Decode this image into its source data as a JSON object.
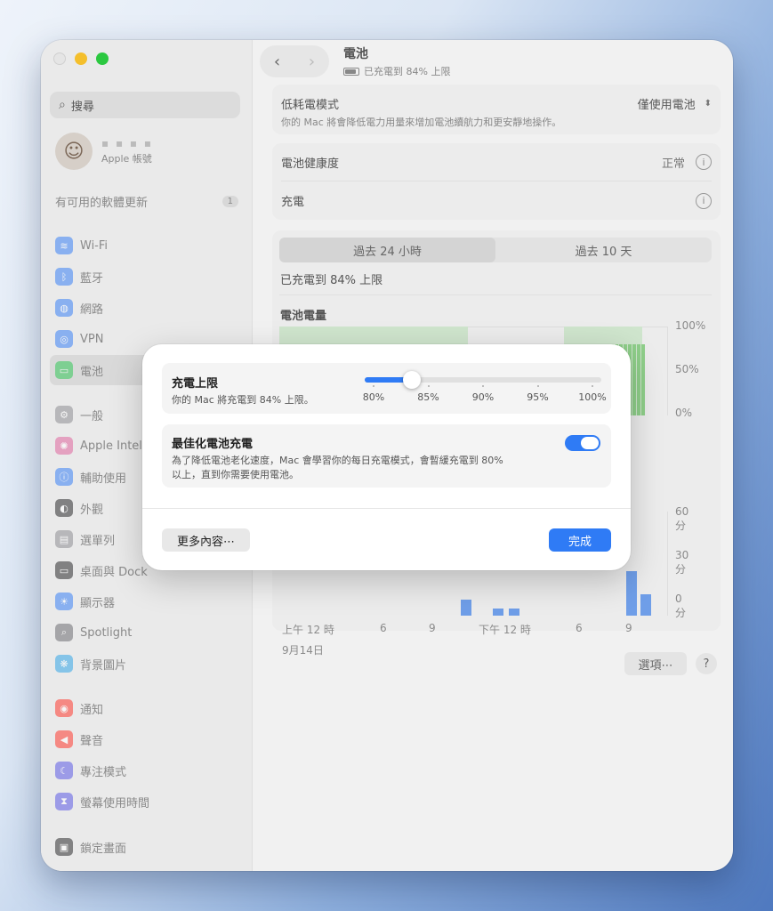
{
  "sidebar": {
    "search_placeholder": "搜尋",
    "account_name": "▪ ▪ ▪ ▪",
    "account_sub": "Apple 帳號",
    "update_label": "有可用的軟體更新",
    "update_count": "1",
    "items": [
      {
        "label": "Wi-Fi",
        "color": "#3b82f6",
        "glyph": "≋"
      },
      {
        "label": "藍牙",
        "color": "#3b82f6",
        "glyph": "ᛒ"
      },
      {
        "label": "網路",
        "color": "#3b82f6",
        "glyph": "◍"
      },
      {
        "label": "VPN",
        "color": "#3b82f6",
        "glyph": "◎"
      },
      {
        "label": "電池",
        "color": "#34c759",
        "glyph": "▭"
      },
      {
        "label": "一般",
        "color": "#8e8e93",
        "glyph": "⚙"
      },
      {
        "label": "Apple Intel",
        "color": "#e0669f",
        "glyph": "✺"
      },
      {
        "label": "輔助使用",
        "color": "#3b82f6",
        "glyph": "ⓘ"
      },
      {
        "label": "外觀",
        "color": "#2c2c2e",
        "glyph": "◐"
      },
      {
        "label": "選單列",
        "color": "#8e8e93",
        "glyph": "▤"
      },
      {
        "label": "桌面與 Dock",
        "color": "#2c2c2e",
        "glyph": "▭"
      },
      {
        "label": "顯示器",
        "color": "#3b82f6",
        "glyph": "☀"
      },
      {
        "label": "Spotlight",
        "color": "#6e6e73",
        "glyph": "⌕"
      },
      {
        "label": "背景圖片",
        "color": "#33a6e8",
        "glyph": "❋"
      },
      {
        "label": "通知",
        "color": "#ff3b30",
        "glyph": "◉"
      },
      {
        "label": "聲音",
        "color": "#ff3b30",
        "glyph": "◀"
      },
      {
        "label": "專注模式",
        "color": "#5e5ce6",
        "glyph": "☾"
      },
      {
        "label": "螢幕使用時間",
        "color": "#5e5ce6",
        "glyph": "⧗"
      },
      {
        "label": "鎖定畫面",
        "color": "#2c2c2e",
        "glyph": "▣"
      }
    ]
  },
  "header": {
    "title": "電池",
    "subtitle": "已充電到 84% 上限"
  },
  "low_power": {
    "title": "低耗電模式",
    "description": "你的 Mac 將會降低電力用量來增加電池續航力和更安靜地操作。",
    "value": "僅使用電池"
  },
  "health": {
    "label": "電池健康度",
    "value": "正常"
  },
  "charging": {
    "label": "充電"
  },
  "segments": {
    "option_24h": "過去 24 小時",
    "option_10d": "過去 10 天"
  },
  "status_text": "已充電到 84% 上限",
  "chart_heading": "電池電量",
  "chart_data": {
    "type": "bar",
    "level_axis": [
      "100%",
      "50%",
      "0%"
    ],
    "usage_axis": [
      "60分",
      "30分",
      "0分"
    ],
    "x_ticks": [
      "上午 12 時",
      "6",
      "9",
      "下午 12 時",
      "6",
      "9"
    ],
    "date_label": "9月14日"
  },
  "buttons": {
    "options": "選項⋯",
    "help": "?"
  },
  "dialog": {
    "limit_title": "充電上限",
    "limit_sub": "你的 Mac 將充電到 84% 上限。",
    "slider_value": 84,
    "slider_min": 80,
    "slider_max": 100,
    "slider_ticks": [
      "80%",
      "85%",
      "90%",
      "95%",
      "100%"
    ],
    "optimized_title": "最佳化電池充電",
    "optimized_sub_1": "為了降低電池老化速度，Mac 會學習你的每日充電模式，會暫緩充電到 80%",
    "optimized_sub_2": "以上，直到你需要使用電池。",
    "optimized_on": true,
    "more_button": "更多內容⋯",
    "done_button": "完成"
  }
}
